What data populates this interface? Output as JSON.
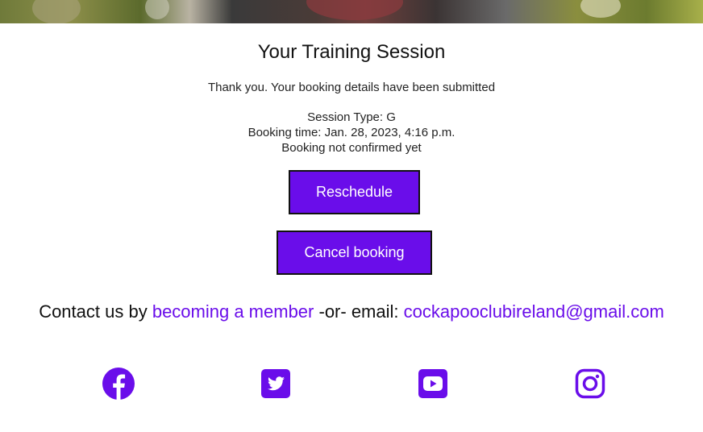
{
  "page": {
    "title": "Your Training Session",
    "thanks": "Thank you. Your booking details have been submitted",
    "session_type": "Session Type: G",
    "booking_time": "Booking time: Jan. 28, 2023, 4:16 p.m.",
    "confirmation_status": "Booking not confirmed yet"
  },
  "buttons": {
    "reschedule": "Reschedule",
    "cancel": "Cancel booking"
  },
  "footer": {
    "contact_prefix": "Contact us by ",
    "member_link": "becoming a member",
    "contact_middle": " -or- email: ",
    "email_link": "cockapooclubireland@gmail.com",
    "social_icons": [
      "facebook-icon",
      "twitter-icon",
      "youtube-icon",
      "instagram-icon"
    ]
  },
  "colors": {
    "accent": "#6a0dea",
    "button_text": "#ffffff",
    "text": "#111111"
  }
}
